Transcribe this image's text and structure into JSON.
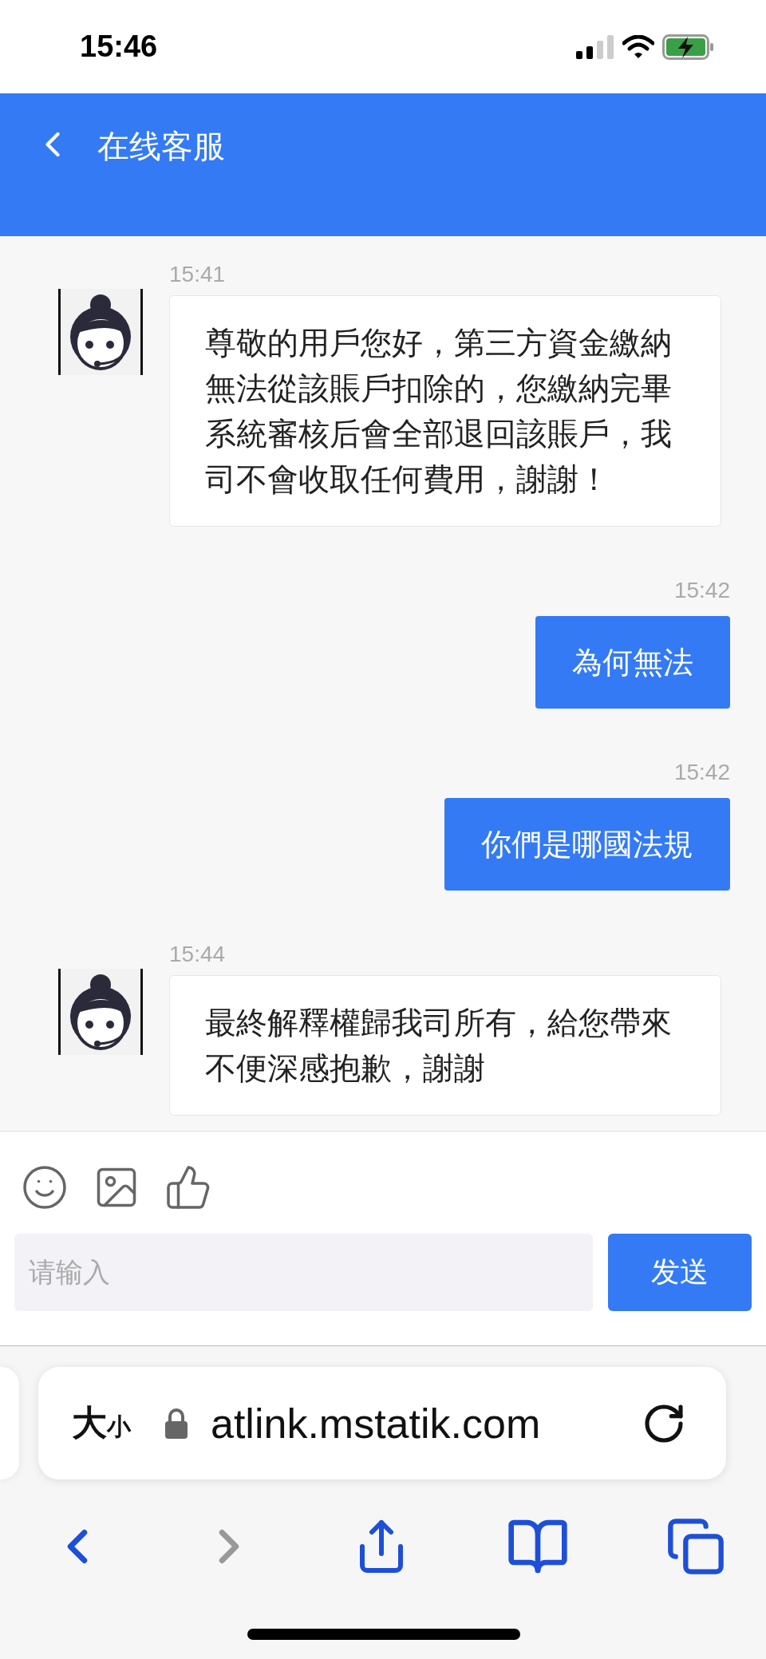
{
  "status_bar": {
    "time": "15:46"
  },
  "header": {
    "title": "在线客服"
  },
  "messages": [
    {
      "kind": "agent",
      "time": "15:41",
      "text": "尊敬的用戶您好，第三方資金繳納無法從該賬戶扣除的，您繳納完畢系統審核后會全部退回該賬戶，我司不會收取任何費用，謝謝！"
    },
    {
      "kind": "user",
      "time": "15:42",
      "text": "為何無法"
    },
    {
      "kind": "user",
      "time": "15:42",
      "text": "你們是哪國法規"
    },
    {
      "kind": "agent",
      "time": "15:44",
      "text": "最終解釋權歸我司所有，給您帶來不便深感抱歉，謝謝"
    }
  ],
  "composer": {
    "placeholder": "请输入",
    "send_button": "发送"
  },
  "browser": {
    "text_size_button": "大小",
    "url": "atlink.mstatik.com"
  }
}
